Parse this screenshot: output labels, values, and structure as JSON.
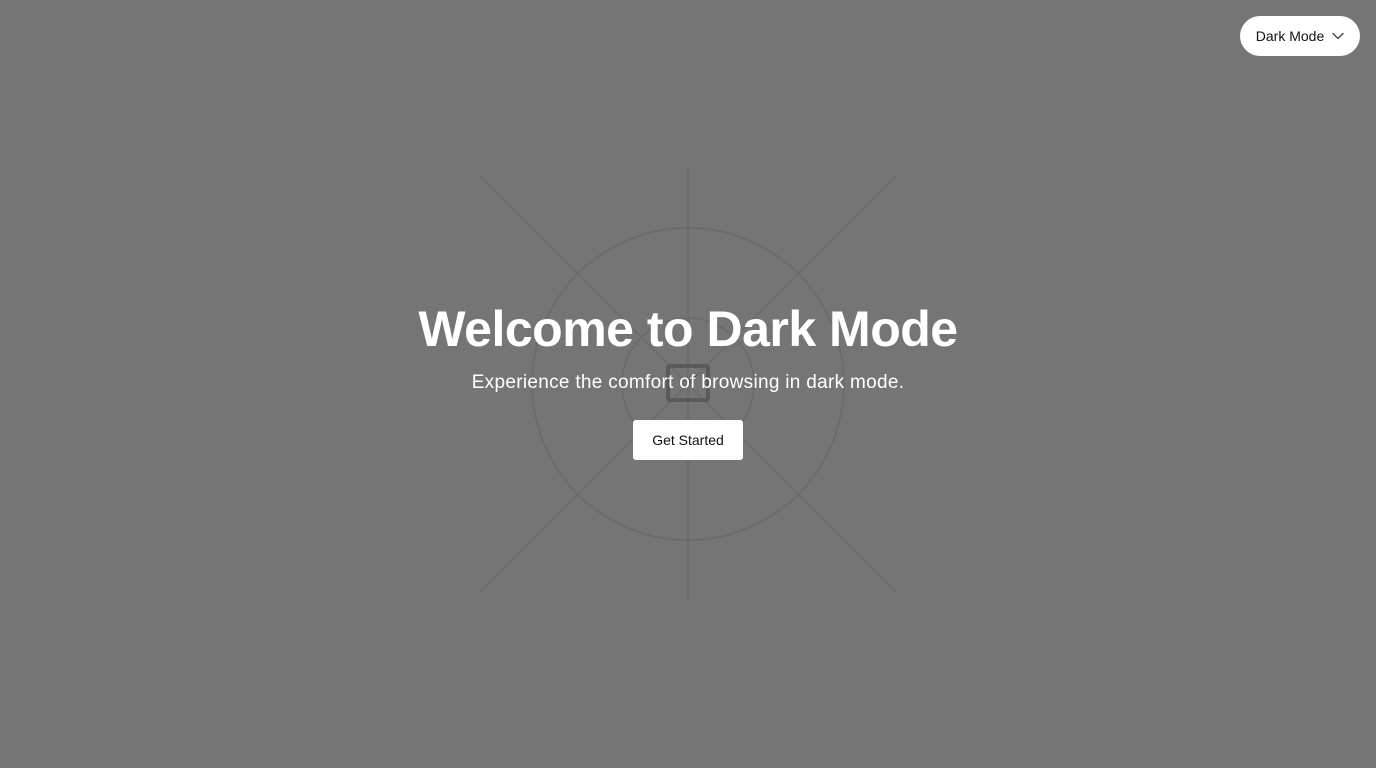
{
  "theme_selector": {
    "label": "Dark Mode",
    "icon": "chevron-down-icon"
  },
  "hero": {
    "title": "Welcome to Dark Mode",
    "subtitle": "Experience the comfort of browsing in dark mode.",
    "cta_label": "Get Started"
  },
  "decoration": {
    "icon": "browser-window-icon"
  },
  "colors": {
    "background": "#757575",
    "text": "#ffffff",
    "button_background": "#ffffff",
    "button_text": "#111111",
    "decoration_stroke": "#6a6a6a"
  }
}
